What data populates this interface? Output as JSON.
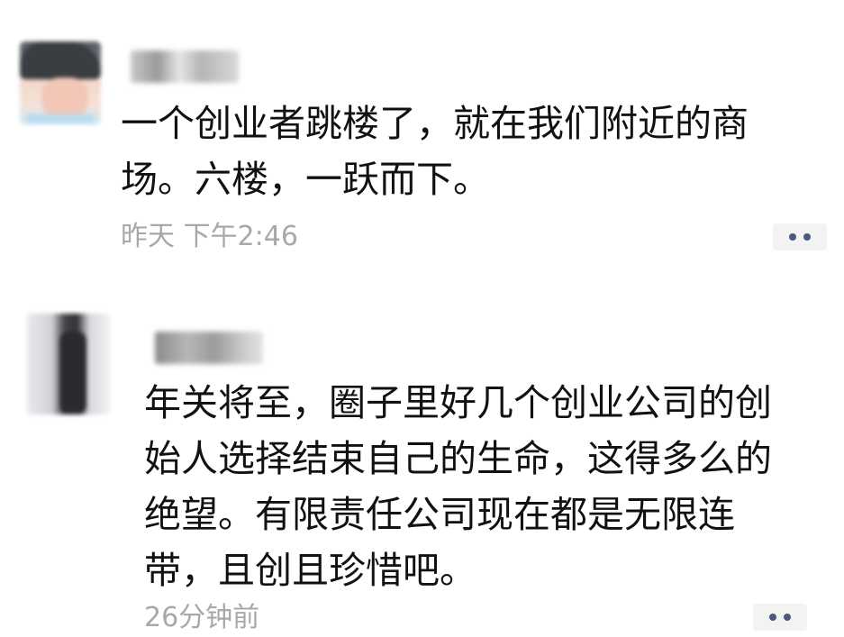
{
  "posts": [
    {
      "content": "一个创业者跳楼了，就在我们附近的商\n场。六楼，一跃而下。",
      "timestamp": "昨天 下午2:46",
      "more_icon": "more-dots-icon"
    },
    {
      "content": "年关将至，圈子里好几个创业公司的创\n始人选择结束自己的生命，这得多么的\n绝望。有限责任公司现在都是无限连\n带，且创且珍惜吧。",
      "timestamp": "26分钟前",
      "more_icon": "more-dots-icon"
    }
  ],
  "colors": {
    "text": "#111111",
    "timestamp": "#a8a8a8",
    "more_button_bg": "#f3f3f3",
    "more_dots": "#4a5a7a"
  }
}
